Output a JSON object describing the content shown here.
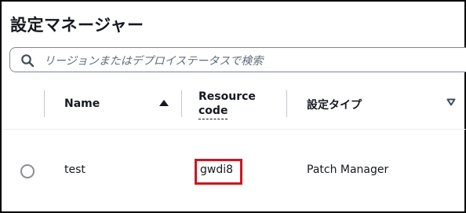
{
  "page": {
    "title": "設定マネージャー"
  },
  "search": {
    "icon": "search-icon",
    "placeholder": "リージョンまたはデプロイステータスで検索"
  },
  "table": {
    "columns": [
      {
        "label": "Name",
        "sort": "ascending"
      },
      {
        "label": "Resource code",
        "label_lines": [
          "Resource",
          "code"
        ],
        "sort": "none"
      },
      {
        "label": "設定タイプ",
        "sort": "descending"
      }
    ],
    "rows": [
      {
        "selected": false,
        "name": "test",
        "resource_code": "gwdi8",
        "type": "Patch Manager"
      }
    ]
  },
  "colors": {
    "highlight": "#d0141f",
    "text": "#16191f",
    "border": "#7d8998"
  }
}
